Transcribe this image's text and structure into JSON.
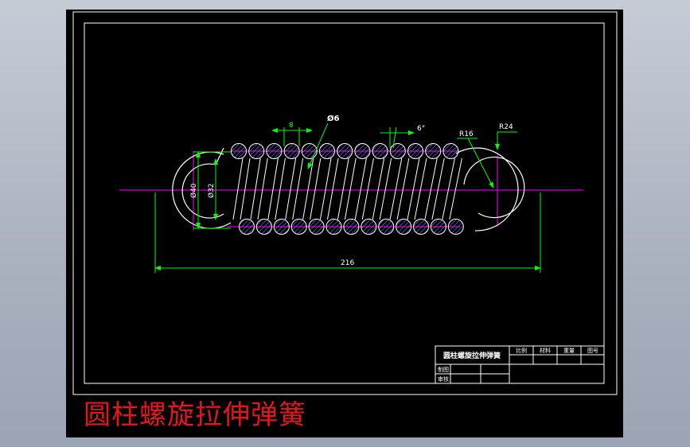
{
  "caption": "圆柱螺旋拉伸弹簧",
  "dimensions": {
    "pitch": "8",
    "wire_diameter": "Ø6",
    "angle": "6°",
    "hook_inner_radius": "R16",
    "hook_outer_radius": "R24",
    "outer_diameter": "Ø40",
    "inner_diameter": "Ø32",
    "overall_length": "216"
  },
  "title_block": {
    "part_name": "圆柱螺旋拉伸弹簧",
    "headers": [
      "比例",
      "材料",
      "重量",
      "图号"
    ],
    "drawn_by_label": "制图",
    "checked_by_label": "审核"
  },
  "colors": {
    "background": "#000000",
    "outline": "#ffffff",
    "centerline": "#ff00ff",
    "dimension": "#00ff00",
    "hatch": "#7777ff",
    "caption": "#e8141b"
  }
}
